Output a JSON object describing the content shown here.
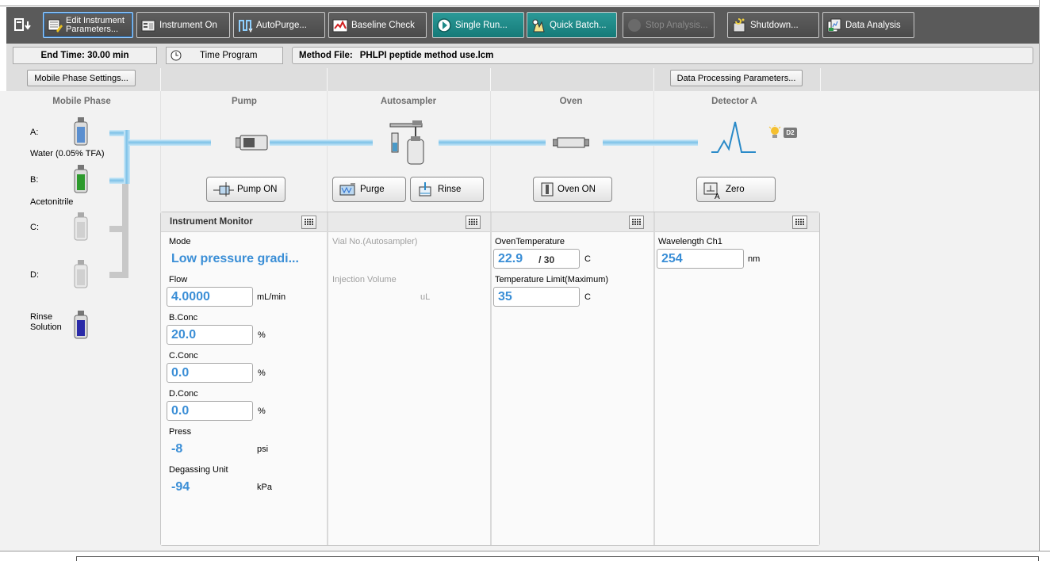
{
  "toolbar": {
    "items": [
      {
        "label": "Edit Instrument Parameters...",
        "label_line1": "Edit Instrument",
        "label_line2": "Parameters...",
        "icon": "edit-parameters-icon",
        "selected": true
      },
      {
        "label": "Instrument On",
        "icon": "instrument-icon"
      },
      {
        "label": "AutoPurge...",
        "icon": "autopurge-icon"
      },
      {
        "label": "Baseline Check",
        "icon": "baseline-check-icon"
      },
      {
        "label": "Single Run...",
        "icon": "single-run-icon",
        "highlight": true
      },
      {
        "label": "Quick Batch...",
        "icon": "quick-batch-icon",
        "highlight": true
      },
      {
        "label": "Stop Analysis...",
        "icon": "stop-icon",
        "disabled": true
      },
      {
        "label": "Shutdown...",
        "icon": "shutdown-icon"
      },
      {
        "label": "Data Analysis",
        "icon": "data-analysis-icon"
      }
    ],
    "colors": {
      "bar": "#5a5a5a",
      "highlight": "#1f8a88"
    }
  },
  "infobar": {
    "end_time": "End Time: 30.00 min",
    "time_program": "Time Program",
    "method_file_label": "Method File:",
    "method_file_value": "PHLPI peptide method use.lcm",
    "mobile_phase_settings": "Mobile Phase Settings...",
    "data_processing_parameters": "Data Processing Parameters..."
  },
  "sections": {
    "mobile_phase": "Mobile Phase",
    "pump": "Pump",
    "autosampler": "Autosampler",
    "oven": "Oven",
    "detector": "Detector A"
  },
  "mobile_phase": {
    "a_label": "A:",
    "a_solvent": "Water (0.05% TFA)",
    "b_label": "B:",
    "b_solvent": "Acetonitrile",
    "c_label": "C:",
    "d_label": "D:",
    "rinse_label_line1": "Rinse",
    "rinse_label_line2": "Solution",
    "bottle_colors": {
      "a": "#5b8fcf",
      "b": "#2d9a2d",
      "c": "#d0d0d0",
      "d": "#d0d0d0",
      "rinse": "#2a2aa8"
    }
  },
  "controls": {
    "pump_on": "Pump ON",
    "purge": "Purge",
    "rinse": "Rinse",
    "oven_on": "Oven ON",
    "zero": "Zero",
    "detector_badge": "D2"
  },
  "monitor": {
    "title": "Instrument Monitor",
    "pump": {
      "mode_label": "Mode",
      "mode_value": "Low pressure gradi...",
      "flow_label": "Flow",
      "flow_value": "4.0000",
      "flow_unit": "mL/min",
      "bconc_label": "B.Conc",
      "bconc_value": "20.0",
      "cconc_label": "C.Conc",
      "cconc_value": "0.0",
      "dconc_label": "D.Conc",
      "dconc_value": "0.0",
      "pct_unit": "%",
      "press_label": "Press",
      "press_value": "-8",
      "press_unit": "psi",
      "degas_label": "Degassing Unit",
      "degas_value": "-94",
      "degas_unit": "kPa"
    },
    "autosampler": {
      "vial_label": "Vial No.(Autosampler)",
      "injection_label": "Injection Volume",
      "injection_unit": "uL"
    },
    "oven": {
      "temp_label": "OvenTemperature",
      "temp_value": "22.9",
      "temp_set": "/ 30",
      "temp_unit": "C",
      "limit_label": "Temperature Limit(Maximum)",
      "limit_value": "35",
      "limit_unit": "C"
    },
    "detector": {
      "wl_label": "Wavelength Ch1",
      "wl_value": "254",
      "wl_unit": "nm"
    }
  }
}
